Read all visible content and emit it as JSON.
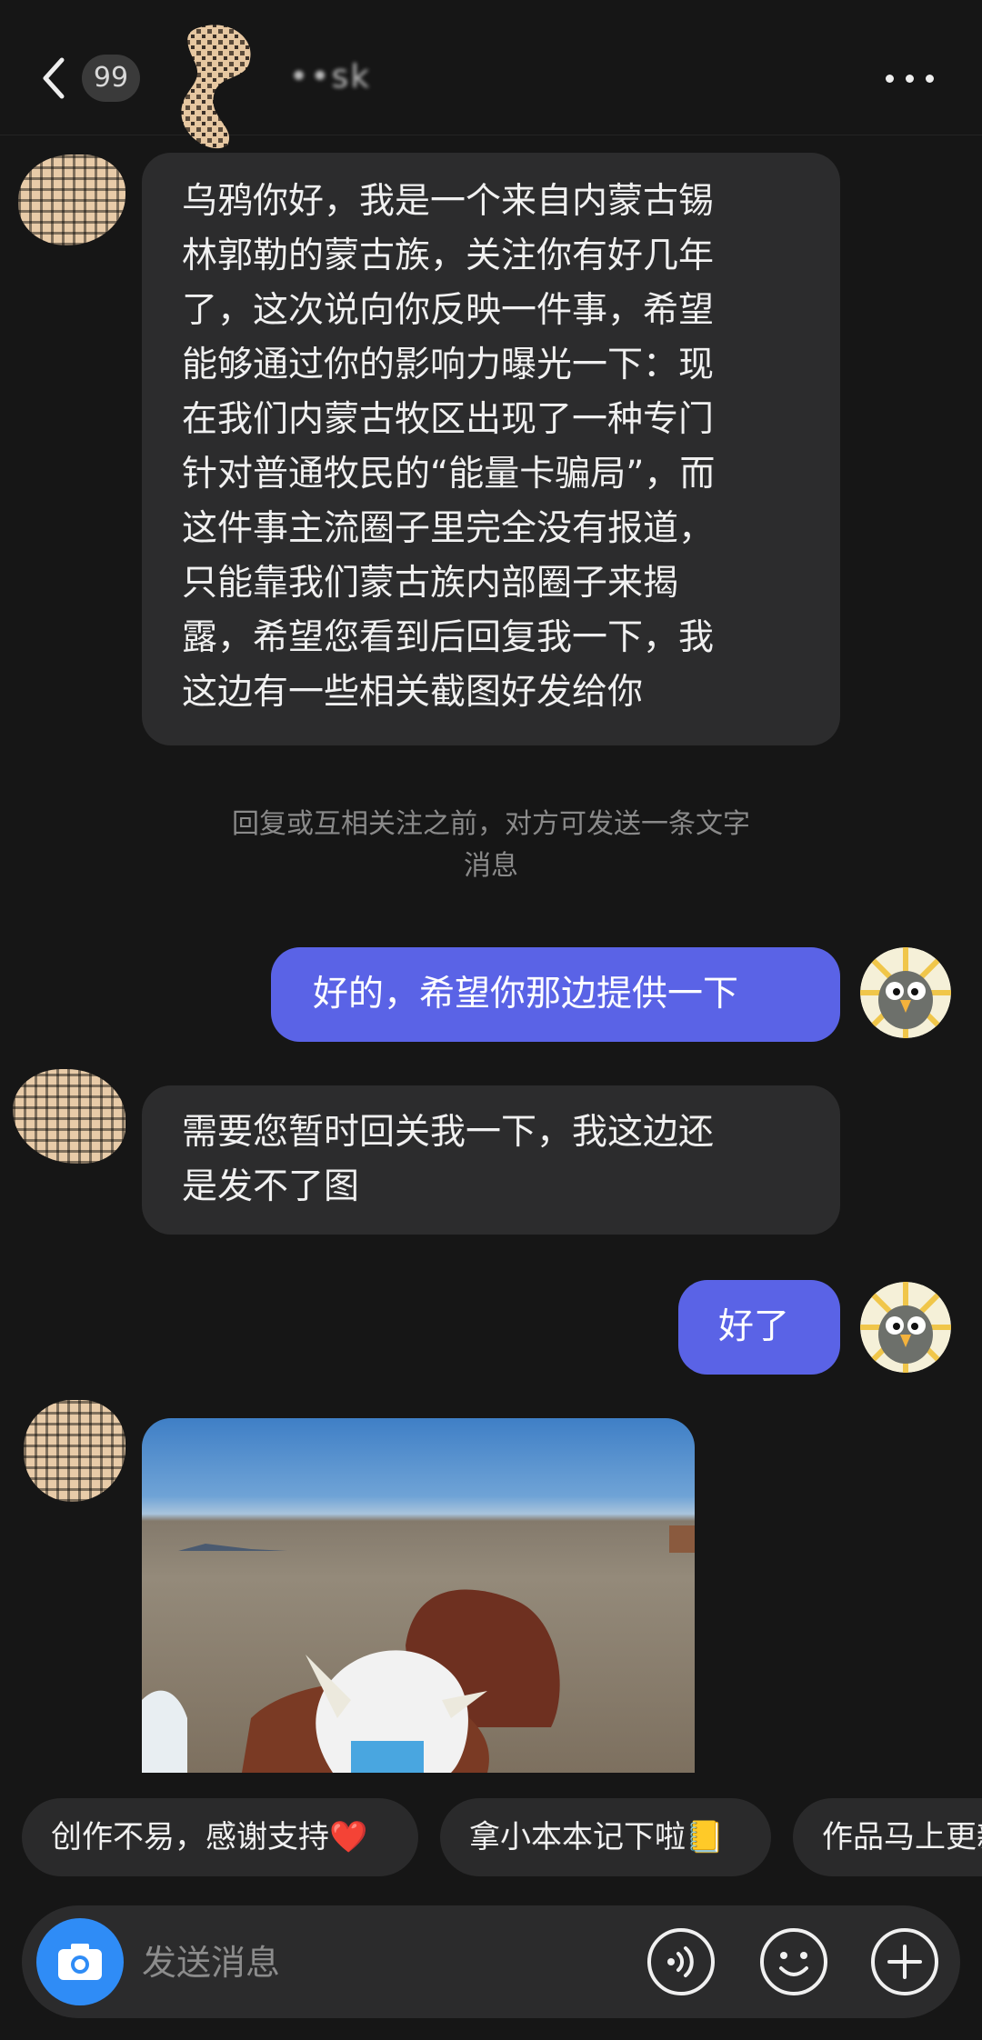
{
  "header": {
    "back_label": "<",
    "unread_count": "99",
    "contact_name": "••sk"
  },
  "messages": [
    {
      "side": "in",
      "lines": [
        "乌鸦你好，我是一个来自内蒙古锡",
        "林郭勒的蒙古族，关注你有好几年",
        "了，这次说向你反映一件事，希望",
        "能够通过你的影响力曝光一下：现",
        "在我们内蒙古牧区出现了一种专门",
        "针对普通牧民的“能量卡骗局”，而",
        "这件事主流圈子里完全没有报道，",
        "只能靠我们蒙古族内部圈子来揭",
        "露，希望您看到后回复我一下，我",
        "这边有一些相关截图好发给你"
      ]
    },
    {
      "side": "out",
      "lines": [
        "好的，希望你那边提供一下"
      ]
    },
    {
      "side": "in",
      "lines": [
        "需要您暂时回关我一下，我这边还",
        "是发不了图"
      ]
    },
    {
      "side": "out",
      "lines": [
        "好了"
      ]
    }
  ],
  "notice_lines": [
    "回复或互相关注之前，对方可发送一条文字",
    "消息"
  ],
  "quick_replies": [
    "创作不易，感谢支持❤️",
    "拿小本本记下啦📒",
    "作品马上更新"
  ],
  "input": {
    "placeholder": "发送消息"
  },
  "icons": {
    "back": "chevron-left-icon",
    "more": "more-dots-icon",
    "camera": "camera-icon",
    "voice": "voice-icon",
    "emoji": "emoji-icon",
    "add": "plus-icon"
  },
  "colors": {
    "background": "#161616",
    "incoming_bubble": "#2c2c2d",
    "outgoing_bubble": "#5a63e6",
    "camera_button": "#2f8cf6"
  }
}
